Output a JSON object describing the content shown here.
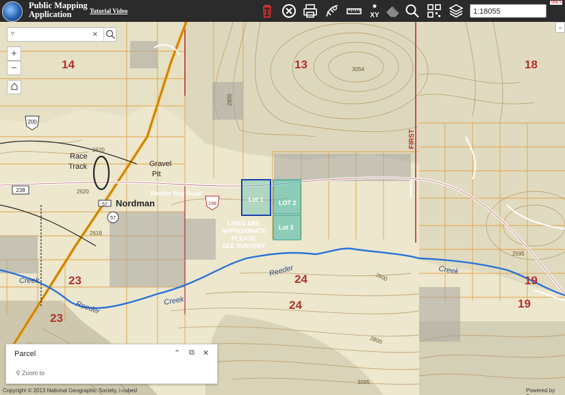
{
  "header": {
    "title": "Public Mapping Application",
    "tutorial_label": "Tutorial Video",
    "scale_value": "1:18055",
    "badge": "SMLS"
  },
  "toolbar_icons": [
    "trash-icon",
    "clear-icon",
    "print-icon",
    "measure-draw-icon",
    "ruler-icon",
    "xy-coordinate-icon",
    "eraser-icon",
    "search-icon",
    "qr-grid-icon",
    "layers-icon"
  ],
  "colors": {
    "toolbar_bg": "#2b2b2b",
    "lot_outline": "#1a3fb0",
    "lot_fill": "#3fb8a8",
    "parcel_line": "#e8a040",
    "highway": "#f0a010",
    "creek": "#2a72d8",
    "section_label": "#b0302c"
  },
  "search": {
    "value": "",
    "placeholder": ""
  },
  "map": {
    "section_labels": [
      "14",
      "13",
      "18",
      "23",
      "24",
      "24",
      "23",
      "19",
      "19"
    ],
    "place_labels": [
      "Race",
      "Track",
      "Gravel",
      "Pit",
      "Nordman",
      "FIRST"
    ],
    "road_label": "Reeder Bay Road",
    "route_shields": [
      "200",
      "238",
      "57",
      "57",
      "198"
    ],
    "elevation_labels": [
      "3054",
      "2800",
      "2620",
      "2620",
      "2619",
      "2600",
      "2800",
      "2595",
      "3095"
    ],
    "creek_labels": [
      "Creek",
      "Reeder",
      "Creek",
      "Reeder",
      "Creek"
    ],
    "lots": [
      "Lot 1",
      "LOT 2",
      "Lot 3"
    ],
    "note_lines": [
      "LINES ARE",
      "APPROXIMATE",
      "PLEASE",
      "SEE SURVERY"
    ]
  },
  "panel": {
    "title": "Parcel",
    "zoom_label": "Zoom to"
  },
  "footer": {
    "copyright": "Copyright © 2013 National Geographic Society, i-cubed",
    "powered": "Powered by Esri"
  }
}
